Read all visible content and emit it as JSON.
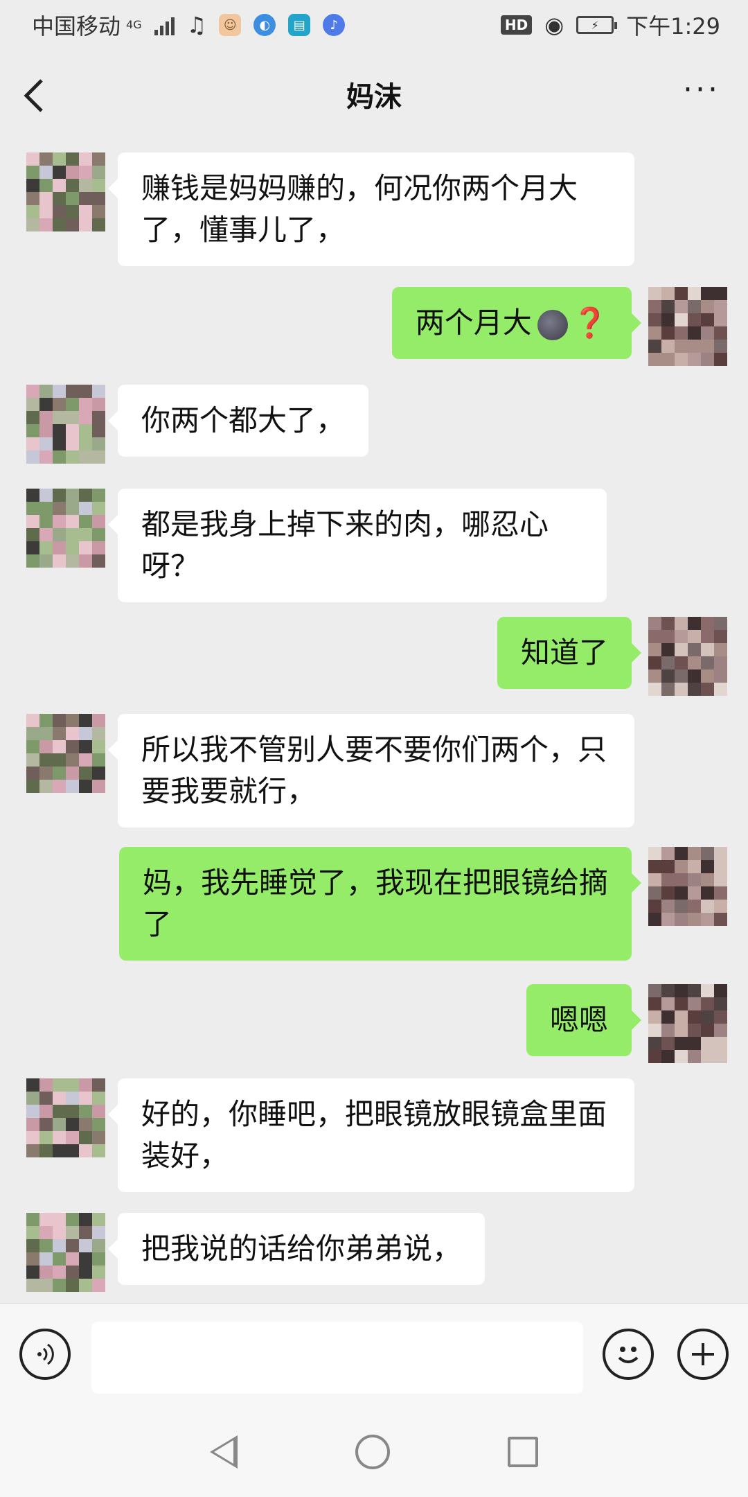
{
  "status_bar": {
    "carrier": "中国移动",
    "network": "4G",
    "time": "下午1:29",
    "hd_badge": "HD",
    "music_icon": "music-note-icon",
    "eye_icon": "eye-icon"
  },
  "header": {
    "back_icon": "‹",
    "title": "妈沫",
    "more_icon": "···"
  },
  "messages": [
    {
      "side": "left",
      "text": "赚钱是妈妈赚的，何况你两个月大了，懂事儿了，"
    },
    {
      "side": "right",
      "text": "两个月大",
      "emoji": "new-moon-face",
      "suffix": "❓"
    },
    {
      "side": "left",
      "text": "你两个都大了，"
    },
    {
      "side": "left",
      "text": "都是我身上掉下来的肉，哪忍心呀？"
    },
    {
      "side": "right",
      "text": "知道了"
    },
    {
      "side": "left",
      "text": "所以我不管别人要不要你们两个，只要我要就行，"
    },
    {
      "side": "right",
      "text": "妈，我先睡觉了，我现在把眼镜给摘了"
    },
    {
      "side": "right",
      "text": "嗯嗯"
    },
    {
      "side": "left",
      "text": "好的，你睡吧，把眼镜放眼镜盒里面装好，"
    },
    {
      "side": "left",
      "text": "把我说的话给你弟弟说，"
    }
  ],
  "input_bar": {
    "voice_icon": "voice-icon",
    "emoji_icon": "emoji-icon",
    "plus_icon": "plus-icon",
    "message_value": ""
  },
  "colors": {
    "background": "#ededed",
    "sent_bubble": "#95ec69",
    "received_bubble": "#ffffff",
    "question_mark": "#e01b1b"
  }
}
